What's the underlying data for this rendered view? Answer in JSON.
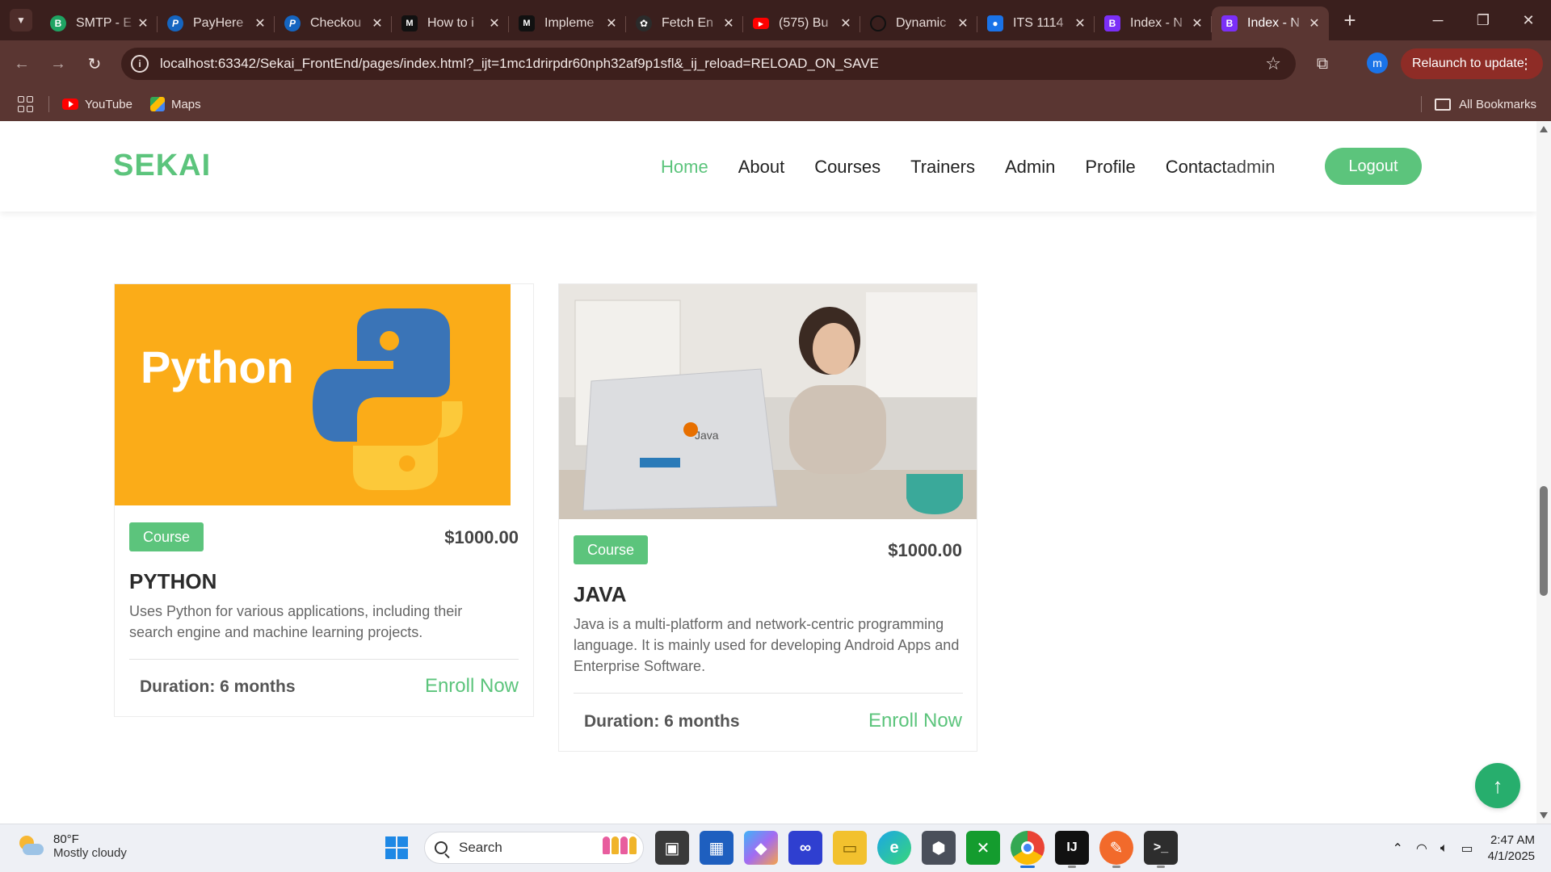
{
  "browser": {
    "tabs": [
      {
        "title": "SMTP - E",
        "favicon": "B",
        "color": "#1fa463"
      },
      {
        "title": "PayHere",
        "favicon": "P",
        "color": "#1565c0"
      },
      {
        "title": "Checkou",
        "favicon": "P",
        "color": "#1565c0"
      },
      {
        "title": "How to i",
        "favicon": "M",
        "color": "#111111"
      },
      {
        "title": "Impleme",
        "favicon": "M",
        "color": "#111111"
      },
      {
        "title": "Fetch En",
        "favicon": "chatgpt",
        "color": "#2b2b2b"
      },
      {
        "title": "(575) Bu",
        "favicon": "yt",
        "color": "#ff0000"
      },
      {
        "title": "Dynamic",
        "favicon": "o",
        "color": "#222222"
      },
      {
        "title": "ITS 1114",
        "favicon": "cls",
        "color": "#1a73e8"
      },
      {
        "title": "Index - N",
        "favicon": "B",
        "color": "#7b2ff7"
      },
      {
        "title": "Index - N",
        "favicon": "B",
        "color": "#7b2ff7",
        "active": true
      }
    ],
    "url": "localhost:63342/Sekai_FrontEnd/pages/index.html?_ijt=1mc1drirpdr60nph32af9p1sfl&_ij_reload=RELOAD_ON_SAVE",
    "profile_initial": "m",
    "relaunch_label": "Relaunch to update",
    "bookmarks": [
      {
        "label": "YouTube"
      },
      {
        "label": "Maps"
      }
    ],
    "all_bookmarks_label": "All Bookmarks"
  },
  "site": {
    "logo": "SEKAI",
    "nav": [
      {
        "label": "Home",
        "active": true
      },
      {
        "label": "About"
      },
      {
        "label": "Courses"
      },
      {
        "label": "Trainers"
      },
      {
        "label": "Admin"
      },
      {
        "label": "Profile"
      },
      {
        "label": "Contact"
      }
    ],
    "username": "admin",
    "logout_label": "Logout"
  },
  "courses": [
    {
      "image_text": "Python",
      "badge": "Course",
      "price": "$1000.00",
      "title": "PYTHON",
      "description": "Uses Python for various applications, including their search engine and machine learning projects.",
      "duration": "Duration: 6 months",
      "enroll": "Enroll Now"
    },
    {
      "image_text": "Java",
      "badge": "Course",
      "price": "$1000.00",
      "title": "JAVA",
      "description": "Java is a multi-platform and network-centric programming language. It is mainly used for developing Android Apps and Enterprise Software.",
      "duration": "Duration: 6 months",
      "enroll": "Enroll Now"
    }
  ],
  "taskbar": {
    "weather_temp": "80°F",
    "weather_desc": "Mostly cloudy",
    "search_placeholder": "Search",
    "time": "2:47 AM",
    "date": "4/1/2025"
  },
  "colors": {
    "brand_green": "#5cc47c",
    "chrome_frame": "#3a1f1d",
    "chrome_toolbar": "#5a3632",
    "relaunch": "#8e2c26"
  }
}
